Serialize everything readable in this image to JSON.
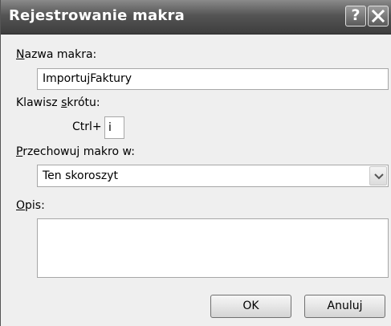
{
  "window": {
    "title": "Rejestrowanie makra",
    "help_glyph": "?",
    "close_icon": "close-icon"
  },
  "macro_name": {
    "label_underlined": "N",
    "label_rest": "azwa makra:",
    "value": "ImportujFaktury"
  },
  "shortcut": {
    "label_before": "Klawisz ",
    "label_underlined": "s",
    "label_after": "krótu:",
    "prefix": "Ctrl+",
    "value": "i"
  },
  "store_in": {
    "label_underlined": "P",
    "label_rest": "rzechowuj makro w:",
    "selected": "Ten skoroszyt",
    "arrow_icon": "chevron-down-icon"
  },
  "description": {
    "label_underlined": "O",
    "label_rest": "pis:",
    "value": ""
  },
  "buttons": {
    "ok": "OK",
    "cancel": "Anuluj"
  },
  "colors": {
    "titlebar": "#555555",
    "dialog_bg": "#efefef"
  }
}
